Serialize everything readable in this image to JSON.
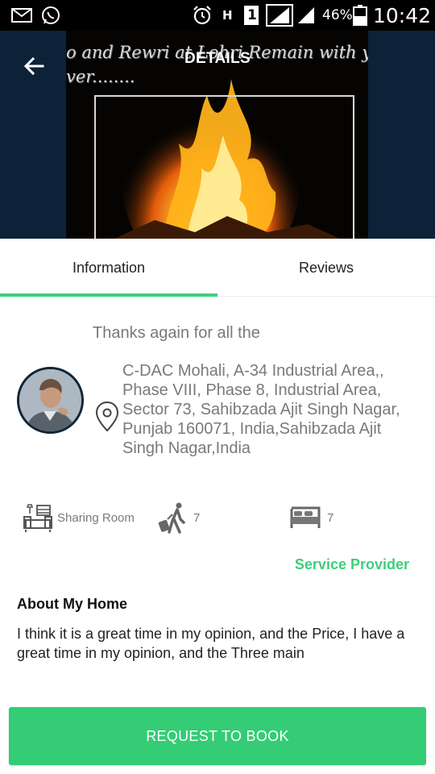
{
  "status_bar": {
    "battery_percent": "46%",
    "time": "10:42",
    "network_type": "H",
    "sim_slot": "1",
    "icons": [
      "mail-icon",
      "whatsapp-icon",
      "alarm-icon",
      "network-h-icon",
      "sim-1-icon",
      "signal-icon",
      "signal-icon-2",
      "battery-icon"
    ]
  },
  "header": {
    "title": "DETAILS",
    "image_caption_line1": "o and Rewri at Lohri Remain with yo",
    "image_caption_line2": "ver........"
  },
  "tabs": [
    {
      "label": "Information",
      "active": true
    },
    {
      "label": "Reviews",
      "active": false
    }
  ],
  "listing": {
    "tagline": "Thanks again for all the",
    "address": "C-DAC Mohali, A-34 Industrial Area,, Phase VIII, Phase 8, Industrial Area, Sector 73, Sahibzada Ajit Singh Nagar, Punjab 160071, India,Sahibzada Ajit Singh Nagar,India",
    "room_type": "Sharing Room",
    "guests": "7",
    "beds": "7",
    "service_provider_label": "Service Provider",
    "about_title": "About My Home",
    "about_text": "I think it is a great time in my opinion, and the Price, I have a great time in my opinion, and the Three main"
  },
  "actions": {
    "book_label": "REQUEST TO BOOK"
  },
  "colors": {
    "accent": "#3ecf7a",
    "button": "#34cc74",
    "header_bg": "#0b2238",
    "text_muted": "#7a7a7a"
  }
}
